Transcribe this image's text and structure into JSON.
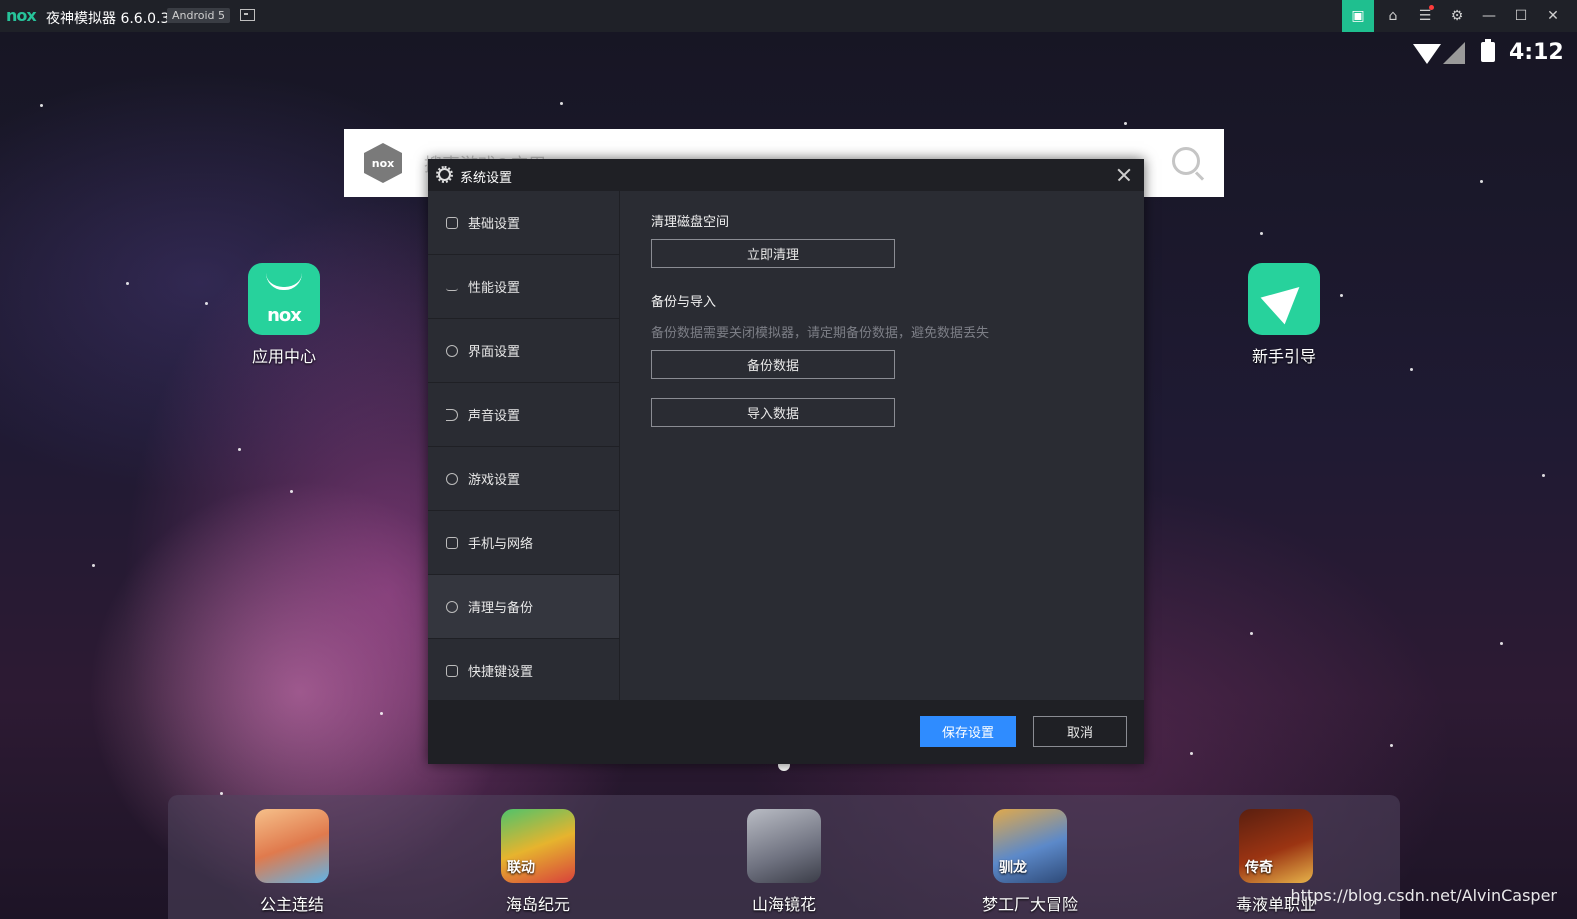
{
  "titlebar": {
    "logo": "nox",
    "title": "夜神模拟器 6.6.0.3",
    "android_badge": "Android 5"
  },
  "statusbar": {
    "time": "4:12"
  },
  "search": {
    "logo": "nox",
    "placeholder": "搜索游戏&应用"
  },
  "desktop_icons": [
    {
      "label": "应用中心",
      "logo_text": "nox"
    },
    {
      "label": "新手引导"
    }
  ],
  "dock_apps": [
    {
      "label": "公主连结"
    },
    {
      "label": "海岛纪元",
      "tile_text": "联动"
    },
    {
      "label": "山海镜花"
    },
    {
      "label": "梦工厂大冒险",
      "tile_text": "驯龙"
    },
    {
      "label": "毒液单职业",
      "tile_text": "传奇"
    }
  ],
  "watermark": "https://blog.csdn.net/AlvinCasper",
  "dialog": {
    "title": "系统设置",
    "nav_items": [
      {
        "label": "基础设置"
      },
      {
        "label": "性能设置"
      },
      {
        "label": "界面设置"
      },
      {
        "label": "声音设置"
      },
      {
        "label": "游戏设置"
      },
      {
        "label": "手机与网络"
      },
      {
        "label": "清理与备份",
        "active": true
      },
      {
        "label": "快捷键设置"
      }
    ],
    "clean": {
      "title": "清理磁盘空间",
      "button": "立即清理"
    },
    "backup": {
      "title": "备份与导入",
      "hint": "备份数据需要关闭模拟器，请定期备份数据，避免数据丢失",
      "backup_button": "备份数据",
      "import_button": "导入数据"
    },
    "footer": {
      "save": "保存设置",
      "cancel": "取消"
    }
  },
  "colors": {
    "accent_green": "#1fbf8f",
    "primary_blue": "#2f8cff",
    "dialog_bg": "#2a2c33"
  }
}
